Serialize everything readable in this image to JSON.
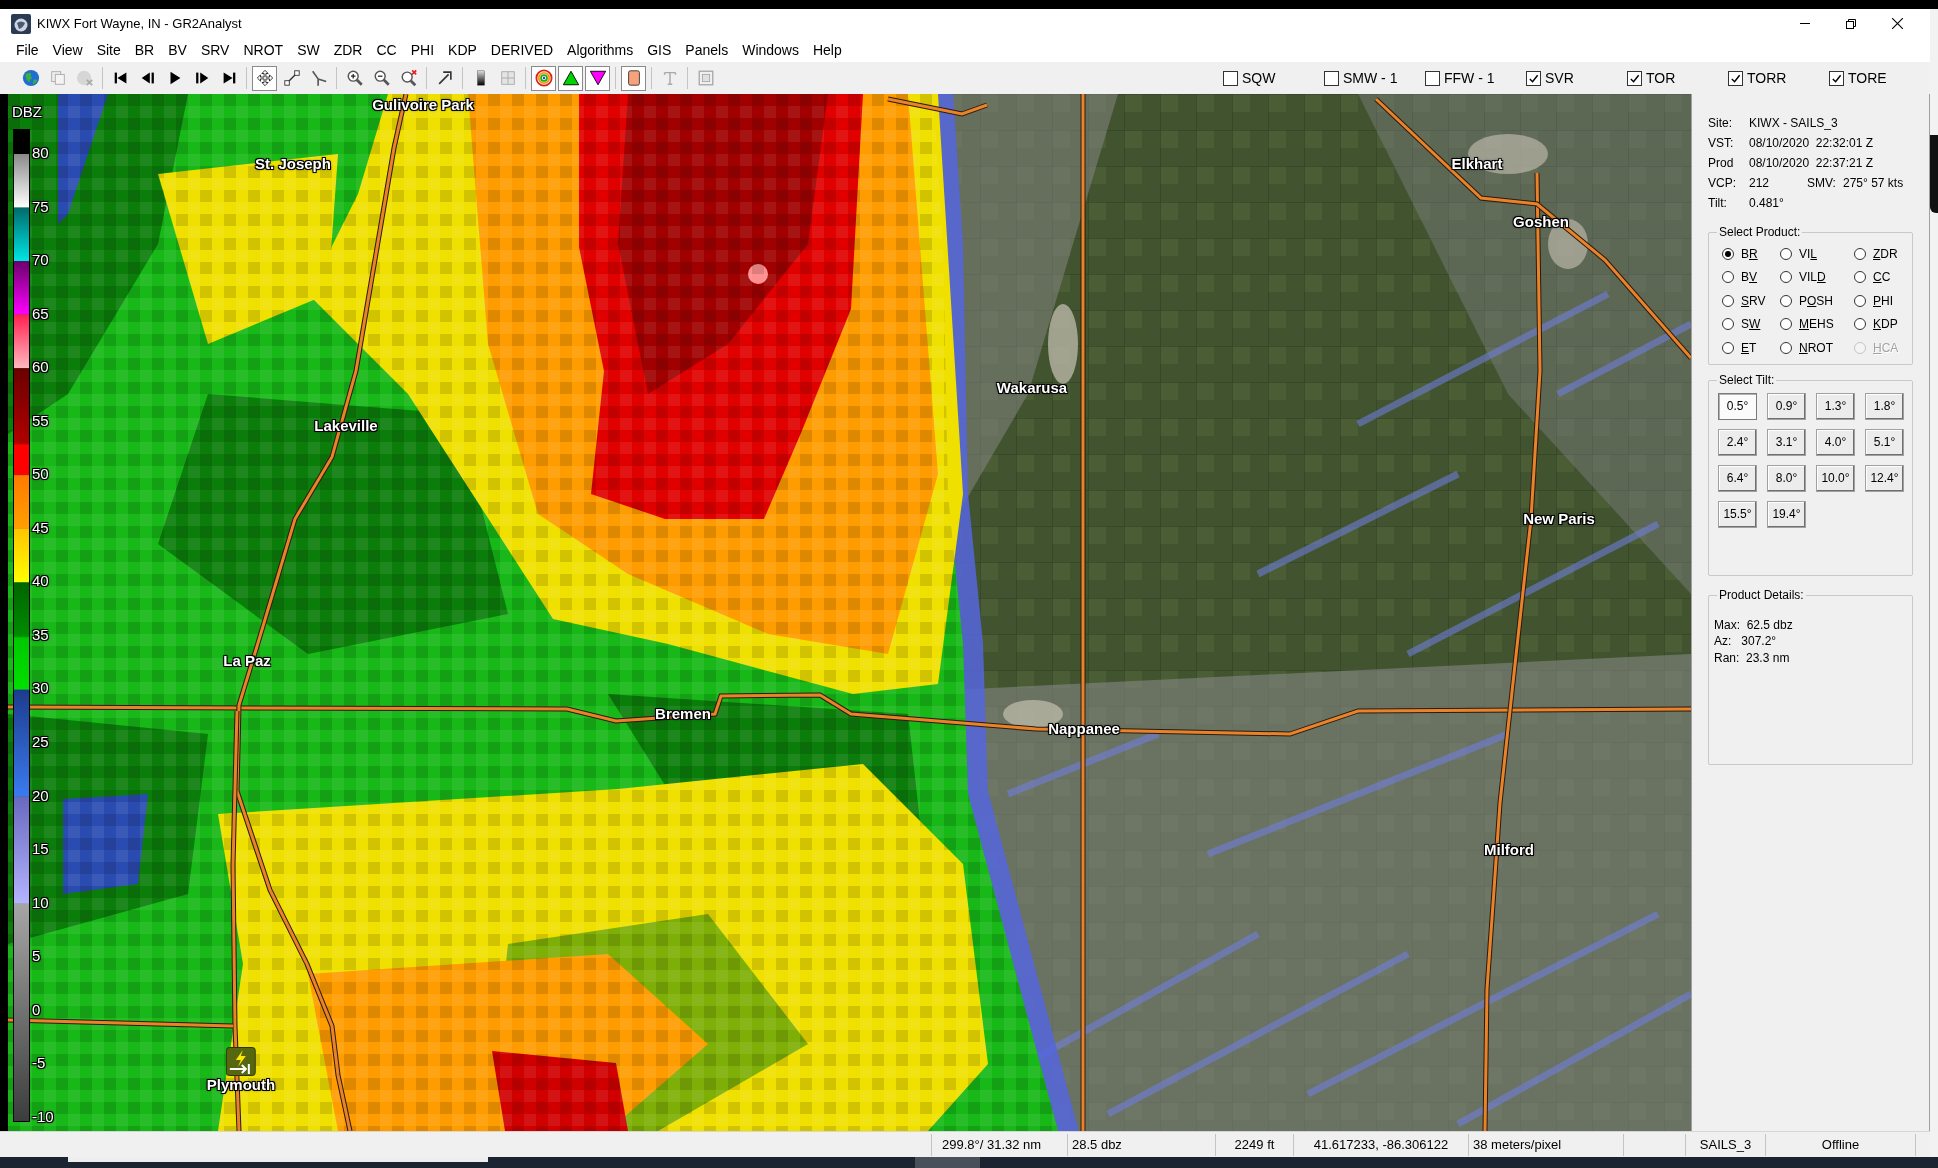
{
  "window": {
    "title": "KIWX Fort Wayne, IN - GR2Analyst"
  },
  "menu": [
    "File",
    "View",
    "Site",
    "BR",
    "BV",
    "SRV",
    "NROT",
    "SW",
    "ZDR",
    "CC",
    "PHI",
    "KDP",
    "DERIVED",
    "Algorithms",
    "GIS",
    "Panels",
    "Windows",
    "Help"
  ],
  "toolbar": {
    "groups": [
      {
        "buttons": [
          {
            "pressed": false,
            "disabled": false
          },
          {
            "pressed": false,
            "disabled": true
          },
          {
            "pressed": false,
            "disabled": true
          }
        ]
      },
      {
        "buttons": [
          {
            "pressed": false,
            "disabled": false
          },
          {
            "pressed": false,
            "disabled": false
          },
          {
            "pressed": false,
            "disabled": false
          },
          {
            "pressed": false,
            "disabled": false
          },
          {
            "pressed": false,
            "disabled": false
          }
        ]
      },
      {
        "buttons": [
          {
            "pressed": true,
            "disabled": false
          },
          {
            "pressed": false,
            "disabled": false
          },
          {
            "pressed": false,
            "disabled": false
          }
        ]
      },
      {
        "buttons": [
          {
            "pressed": false,
            "disabled": false
          },
          {
            "pressed": false,
            "disabled": false
          },
          {
            "pressed": false,
            "disabled": false
          }
        ]
      },
      {
        "buttons": [
          {
            "pressed": false,
            "disabled": false
          }
        ]
      },
      {
        "buttons": [
          {
            "pressed": false,
            "disabled": false
          },
          {
            "pressed": false,
            "disabled": true
          }
        ]
      },
      {
        "buttons": [
          {
            "pressed": true,
            "disabled": false
          },
          {
            "pressed": true,
            "disabled": false
          },
          {
            "pressed": true,
            "disabled": false
          }
        ]
      },
      {
        "buttons": [
          {
            "pressed": true,
            "disabled": false
          }
        ]
      },
      {
        "buttons": [
          {
            "pressed": false,
            "disabled": true
          }
        ]
      },
      {
        "buttons": [
          {
            "pressed": false,
            "disabled": true
          }
        ]
      }
    ]
  },
  "warning_filters": [
    {
      "label": "SQW",
      "checked": false
    },
    {
      "label": "SMW - 1",
      "checked": false
    },
    {
      "label": "FFW - 1",
      "checked": false
    },
    {
      "label": "SVR",
      "checked": true
    },
    {
      "label": "TOR",
      "checked": true
    },
    {
      "label": "TORR",
      "checked": true
    },
    {
      "label": "TORE",
      "checked": true
    }
  ],
  "map": {
    "legend": {
      "unit": "DBZ",
      "ticks": [
        "80",
        "75",
        "70",
        "65",
        "60",
        "55",
        "50",
        "45",
        "40",
        "35",
        "30",
        "25",
        "20",
        "15",
        "10",
        "5",
        "0",
        "-5",
        "-10"
      ]
    },
    "places": [
      {
        "name": "Gulivoire Park",
        "marker": false
      },
      {
        "name": "St. Joseph",
        "marker": false
      },
      {
        "name": "Lakeville",
        "marker": false
      },
      {
        "name": "La Paz",
        "marker": false
      },
      {
        "name": "Bremen",
        "marker": false
      },
      {
        "name": "Plymouth",
        "marker": true
      },
      {
        "name": "Wakarusa",
        "marker": false
      },
      {
        "name": "Nappanee",
        "marker": false
      },
      {
        "name": "Elkhart",
        "marker": false
      },
      {
        "name": "Goshen",
        "marker": false
      },
      {
        "name": "New Paris",
        "marker": false
      },
      {
        "name": "Milford",
        "marker": false
      }
    ]
  },
  "side_panel": {
    "info": [
      {
        "label": "Site:",
        "value": "KIWX - SAILS_3"
      },
      {
        "label": "VST:",
        "value": "08/10/2020  22:32:01 Z"
      },
      {
        "label": "Prod",
        "value": "08/10/2020  22:37:21 Z"
      },
      {
        "label": "VCP:",
        "value": "212",
        "extra_label": "SMV:",
        "extra_value": "275° 57 kts"
      },
      {
        "label": "Tilt:",
        "value": "0.481°"
      }
    ],
    "select_product": {
      "title": "Select Product:",
      "options": [
        {
          "before": "B",
          "key": "R",
          "selected": true,
          "disabled": false
        },
        {
          "before": "VI",
          "key": "L",
          "selected": false,
          "disabled": false
        },
        {
          "key": "Z",
          "after": "DR",
          "selected": false,
          "disabled": false
        },
        {
          "before": "B",
          "key": "V",
          "selected": false,
          "disabled": false
        },
        {
          "before": "VIL",
          "key": "D",
          "selected": false,
          "disabled": false
        },
        {
          "key": "C",
          "after": "C",
          "selected": false,
          "disabled": false
        },
        {
          "key": "S",
          "after": "RV",
          "selected": false,
          "disabled": false
        },
        {
          "before": "P",
          "key": "O",
          "after": "SH",
          "selected": false,
          "disabled": false
        },
        {
          "key": "P",
          "after": "HI",
          "selected": false,
          "disabled": false
        },
        {
          "before": "S",
          "key": "W",
          "selected": false,
          "disabled": false
        },
        {
          "key": "M",
          "after": "EHS",
          "selected": false,
          "disabled": false
        },
        {
          "key": "K",
          "after": "DP",
          "selected": false,
          "disabled": false
        },
        {
          "key": "E",
          "after": "T",
          "selected": false,
          "disabled": false
        },
        {
          "key": "N",
          "after": "ROT",
          "selected": false,
          "disabled": false
        },
        {
          "key": "H",
          "after": "CA",
          "selected": false,
          "disabled": true
        }
      ]
    },
    "select_tilt": {
      "title": "Select Tilt:",
      "tilts": [
        {
          "label": "0.5°",
          "selected": true
        },
        {
          "label": "0.9°",
          "selected": false
        },
        {
          "label": "1.3°",
          "selected": false
        },
        {
          "label": "1.8°",
          "selected": false
        },
        {
          "label": "2.4°",
          "selected": false
        },
        {
          "label": "3.1°",
          "selected": false
        },
        {
          "label": "4.0°",
          "selected": false
        },
        {
          "label": "5.1°",
          "selected": false
        },
        {
          "label": "6.4°",
          "selected": false
        },
        {
          "label": "8.0°",
          "selected": false
        },
        {
          "label": "10.0°",
          "selected": false
        },
        {
          "label": "12.4°",
          "selected": false
        },
        {
          "label": "15.5°",
          "selected": false
        },
        {
          "label": "19.4°",
          "selected": false
        }
      ]
    },
    "product_details": {
      "title": "Product Details:",
      "lines": [
        "Max:  62.5 dbz",
        "Az:   307.2°",
        "Ran:  23.3 nm"
      ]
    }
  },
  "status_bar": {
    "fields": [
      "299.8°/ 31.32 nm",
      "28.5 dbz",
      "2249 ft",
      "41.617233, -86.306122",
      "38 meters/pixel",
      "SAILS_3",
      "Offline"
    ]
  }
}
